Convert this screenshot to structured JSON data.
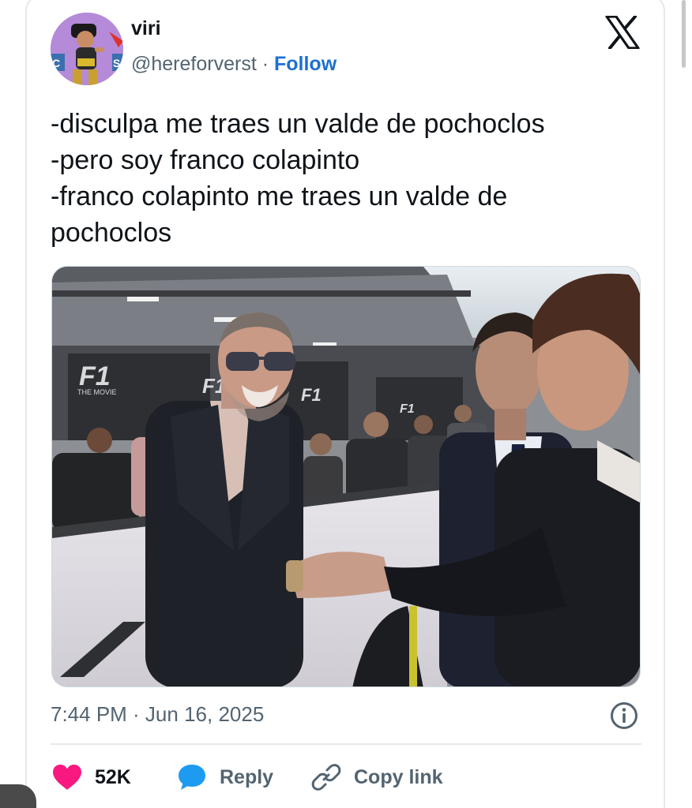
{
  "author": {
    "display_name": "viri",
    "handle": "@hereforverst",
    "separator": "·",
    "follow_label": "Follow"
  },
  "tweet": {
    "lines": [
      "-disculpa me traes un valde de pochoclos",
      "-pero soy franco colapinto",
      "-franco colapinto me traes un valde de",
      "pochoclos"
    ],
    "timestamp": "7:44 PM · Jun 16, 2025"
  },
  "media": {
    "logo_text": "THE MOVIE"
  },
  "actions": {
    "likes": "52K",
    "reply_label": "Reply",
    "copy_link_label": "Copy link"
  },
  "icons": {
    "platform": "x-logo-icon",
    "info": "info-icon",
    "like": "heart-icon",
    "reply": "reply-bubble-icon",
    "copy": "link-icon"
  },
  "colors": {
    "heart": "#f91880",
    "reply": "#1d9bf0",
    "follow": "#1d6fd1",
    "text": "#0f1419",
    "muted": "#536471"
  }
}
